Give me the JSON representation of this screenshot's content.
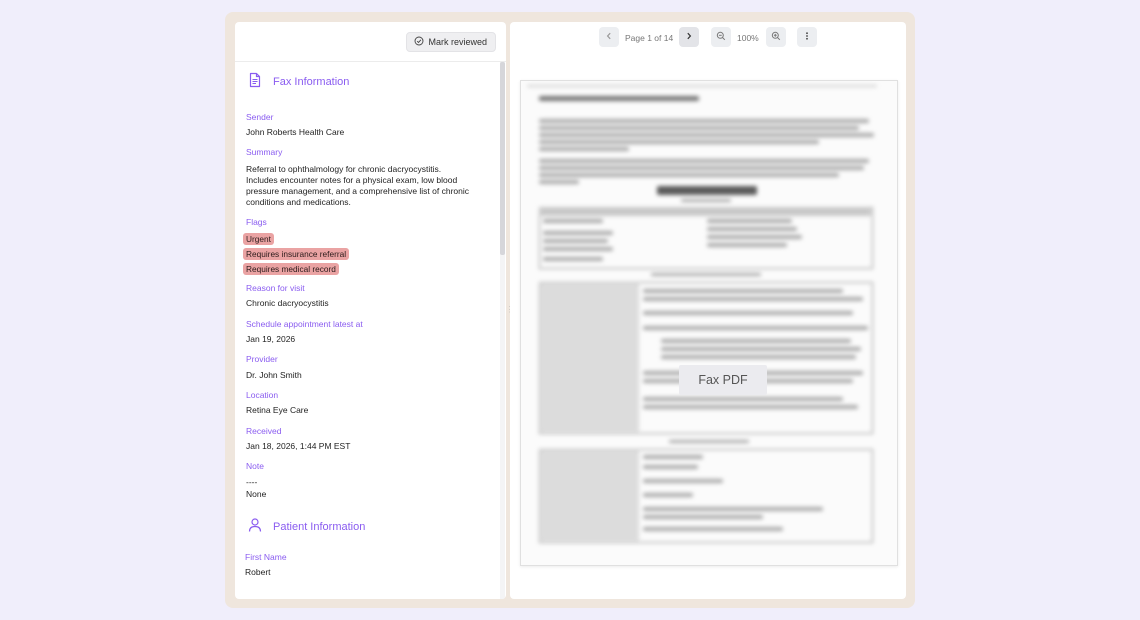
{
  "toolbar": {
    "mark_reviewed_label": "Mark reviewed",
    "page_indicator": "Page 1 of 14",
    "zoom_level": "100%"
  },
  "fax_info": {
    "title": "Fax Information",
    "fields": {
      "sender_label": "Sender",
      "sender_value": "John Roberts Health Care",
      "summary_label": "Summary",
      "summary_value": "Referral to ophthalmology for chronic dacryocystitis. Includes encounter notes for a physical exam, low blood pressure management, and a comprehensive list of chronic conditions and medications.",
      "flags_label": "Flags",
      "reason_label": "Reason for visit",
      "reason_value": "Chronic dacryocystitis",
      "schedule_label": "Schedule appointment latest at",
      "schedule_value": "Jan 19, 2026",
      "provider_label": "Provider",
      "provider_value": "Dr. John Smith",
      "location_label": "Location",
      "location_value": "Retina Eye Care",
      "received_label": "Received",
      "received_value": "Jan 18, 2026, 1:44 PM EST",
      "note_label": "Note",
      "note_dashes": "----",
      "note_value": "None"
    },
    "flags": [
      "Urgent",
      "Requires insurance referral",
      "Requires medical record"
    ]
  },
  "patient_info": {
    "title": "Patient Information",
    "first_name_label": "First Name",
    "first_name_value": "Robert"
  },
  "pdf_viewer": {
    "overlay_label": "Fax PDF",
    "document_title": "Referral Order"
  },
  "colors": {
    "accent": "#8a5cf0",
    "flag_bg": "#eaa3a3",
    "frame_bg": "#efe6dd",
    "page_bg": "#f0eefb"
  },
  "icons": {
    "mark_reviewed": "check-circle-icon",
    "fax_section": "document-icon",
    "patient_section": "person-icon",
    "prev_page": "chevron-left-icon",
    "next_page": "chevron-right-icon",
    "zoom_out": "zoom-out-icon",
    "zoom_in": "zoom-in-icon",
    "more": "more-vertical-icon"
  }
}
